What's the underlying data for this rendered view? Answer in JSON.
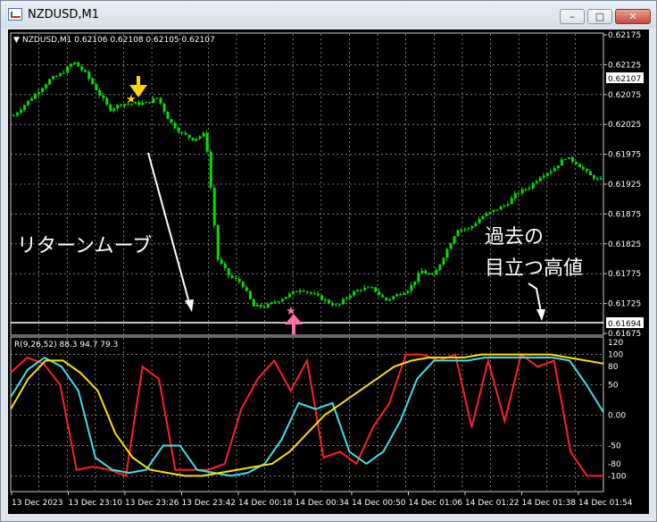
{
  "window": {
    "title": "NZDUSD,M1",
    "minimize_glyph": "–",
    "maximize_glyph": "□",
    "close_glyph": "✕"
  },
  "chart": {
    "header": "NZDUSD,M1  0.62106 0.62108 0.62105 0.62107",
    "indicator_header": "R(9,26,52) 88.3 94.7 79.3",
    "bid_price_label": "0.62107",
    "level_price_label": "0.61694",
    "price_axis_labels": [
      "0.62175",
      "0.62125",
      "0.62075",
      "0.62025",
      "0.61975",
      "0.61925",
      "0.61875",
      "0.61825",
      "0.61775",
      "0.61725",
      "0.61675"
    ],
    "indicator_axis_labels": [
      "120",
      "100",
      "80",
      "50",
      "0.00",
      "-50",
      "-80",
      "-100"
    ],
    "time_axis_labels": [
      "13 Dec 2023",
      "13 Dec 23:10",
      "13 Dec 23:26",
      "13 Dec 23:42",
      "14 Dec 00:18",
      "14 Dec 00:34",
      "14 Dec 00:50",
      "14 Dec 01:06",
      "14 Dec 01:22",
      "14 Dec 01:38",
      "14 Dec 01:54"
    ],
    "annotation_return_move": "リターンムーブ",
    "annotation_past_high_line1": "過去の",
    "annotation_past_high_line2": "目立つ高値",
    "colors": {
      "background": "#000000",
      "grid": "#c8c8c8",
      "candles": "#00e000",
      "indicator_fast": "#ff2020",
      "indicator_mid": "#40e0e8",
      "indicator_slow": "#ffe000",
      "sell_arrow": "#ffd400",
      "buy_arrow": "#ff6fa8",
      "level_line": "#ffffff"
    }
  },
  "chart_data": {
    "type": "candlestick",
    "symbol": "NZDUSD",
    "timeframe": "M1",
    "ylim": [
      0.61675,
      0.62175
    ],
    "close_path": [
      0.6204,
      0.6206,
      0.6208,
      0.621,
      0.6211,
      0.6213,
      0.6211,
      0.6208,
      0.6205,
      0.6206,
      0.6206,
      0.6206,
      0.6207,
      0.6203,
      0.6201,
      0.62,
      0.6201,
      0.618,
      0.6177,
      0.6176,
      0.6172,
      0.6172,
      0.6173,
      0.6174,
      0.6175,
      0.6174,
      0.6173,
      0.6172,
      0.6174,
      0.6175,
      0.6175,
      0.6173,
      0.6174,
      0.6175,
      0.6178,
      0.6177,
      0.6181,
      0.6185,
      0.6185,
      0.6187,
      0.6188,
      0.6189,
      0.6191,
      0.6192,
      0.6194,
      0.6195,
      0.6197,
      0.6196,
      0.6194,
      0.6193
    ],
    "past_high_level": 0.61694,
    "current_bid": 0.62107,
    "indicator": {
      "name": "R(9,26,52)",
      "ylim": [
        -120,
        120
      ],
      "series": [
        {
          "name": "9",
          "last": 88.3,
          "values": [
            70,
            95,
            85,
            50,
            -90,
            -85,
            -90,
            -100,
            80,
            60,
            -90,
            -90,
            -90,
            -80,
            10,
            60,
            90,
            40,
            90,
            -70,
            -60,
            -80,
            -20,
            20,
            100,
            100,
            90,
            100,
            -20,
            90,
            -10,
            100,
            80,
            90,
            -60,
            -100,
            -100
          ]
        },
        {
          "name": "26",
          "last": 94.7,
          "values": [
            30,
            75,
            95,
            80,
            40,
            -70,
            -90,
            -95,
            -90,
            -50,
            -50,
            -90,
            -95,
            -100,
            -95,
            -80,
            -40,
            20,
            10,
            20,
            -60,
            -80,
            -60,
            -10,
            60,
            90,
            90,
            90,
            95,
            95,
            95,
            95,
            95,
            90,
            50,
            5
          ]
        },
        {
          "name": "52",
          "last": 79.3,
          "values": [
            10,
            60,
            90,
            90,
            70,
            40,
            -30,
            -70,
            -90,
            -95,
            -100,
            -100,
            -95,
            -90,
            -85,
            -80,
            -60,
            -30,
            0,
            20,
            40,
            60,
            80,
            90,
            95,
            95,
            95,
            100,
            100,
            100,
            100,
            100,
            95,
            90,
            85
          ]
        }
      ]
    }
  }
}
